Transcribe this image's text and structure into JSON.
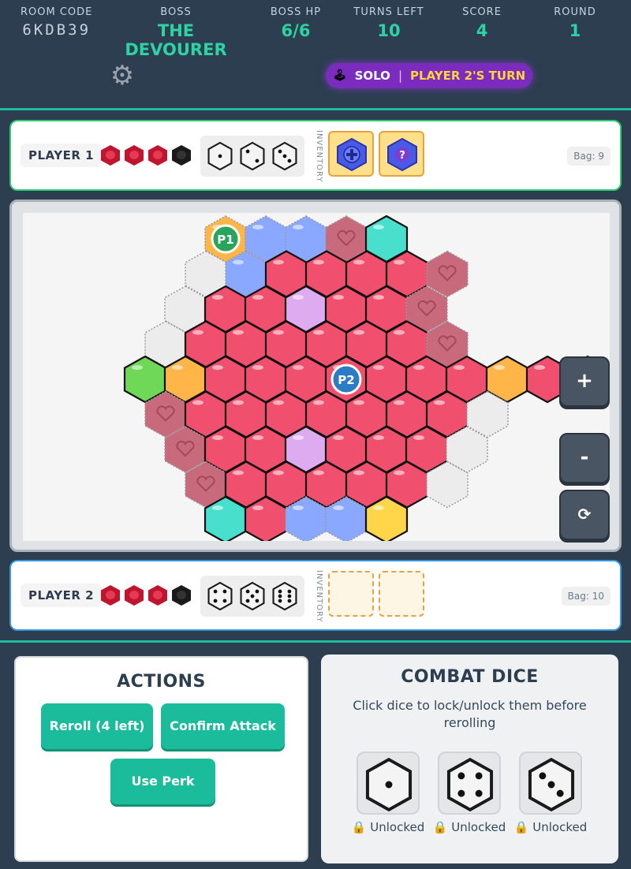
{
  "header": {
    "stats": [
      {
        "label": "ROOM CODE",
        "value": "6KDB39"
      },
      {
        "label": "BOSS",
        "value": "THE DEVOURER"
      },
      {
        "label": "BOSS HP",
        "value": "6/6"
      },
      {
        "label": "TURNS LEFT",
        "value": "10"
      },
      {
        "label": "SCORE",
        "value": "4"
      },
      {
        "label": "ROUND",
        "value": "1"
      }
    ],
    "mode_icon": "joystick-icon",
    "mode": "SOLO",
    "separator": "|",
    "turn_text": "PLAYER 2'S TURN",
    "settings_icon": "gear-icon"
  },
  "player1": {
    "name": "PLAYER 1",
    "hearts_full": 3,
    "hearts_total": 4,
    "dice": [
      1,
      2,
      3
    ],
    "inventory_label": "INVENTORY",
    "inventory": [
      "heal-perk-icon",
      "mystery-perk-icon"
    ],
    "bag": "Bag: 9"
  },
  "player2": {
    "name": "PLAYER 2",
    "hearts_full": 3,
    "hearts_total": 4,
    "dice": [
      4,
      5,
      6
    ],
    "inventory_label": "INVENTORY",
    "inventory": [],
    "bag": "Bag: 10"
  },
  "board": {
    "token_p1": "P1",
    "token_p2": "P2",
    "colors": {
      "red": "#f0506e",
      "heart": "#c86a7c",
      "blue": "#8aa8ff",
      "teal": "#48e0cc",
      "green": "#6fd856",
      "orange": "#ffb547",
      "purple": "#7f3be8",
      "lilac": "#deaaf0",
      "yellow": "#ffd54a",
      "empty": "#ececec"
    },
    "zoom_in": "+",
    "zoom_out": "-",
    "reset": "⟳"
  },
  "actions": {
    "title": "ACTIONS",
    "reroll": "Reroll (4 left)",
    "confirm": "Confirm Attack",
    "perk": "Use Perk"
  },
  "combat": {
    "title": "COMBAT DICE",
    "description": "Click dice to lock/unlock them before rerolling",
    "dice": [
      {
        "value": 1,
        "status": "Unlocked"
      },
      {
        "value": 4,
        "status": "Unlocked"
      },
      {
        "value": 3,
        "status": "Unlocked"
      }
    ],
    "lock_icon": "🔒"
  }
}
